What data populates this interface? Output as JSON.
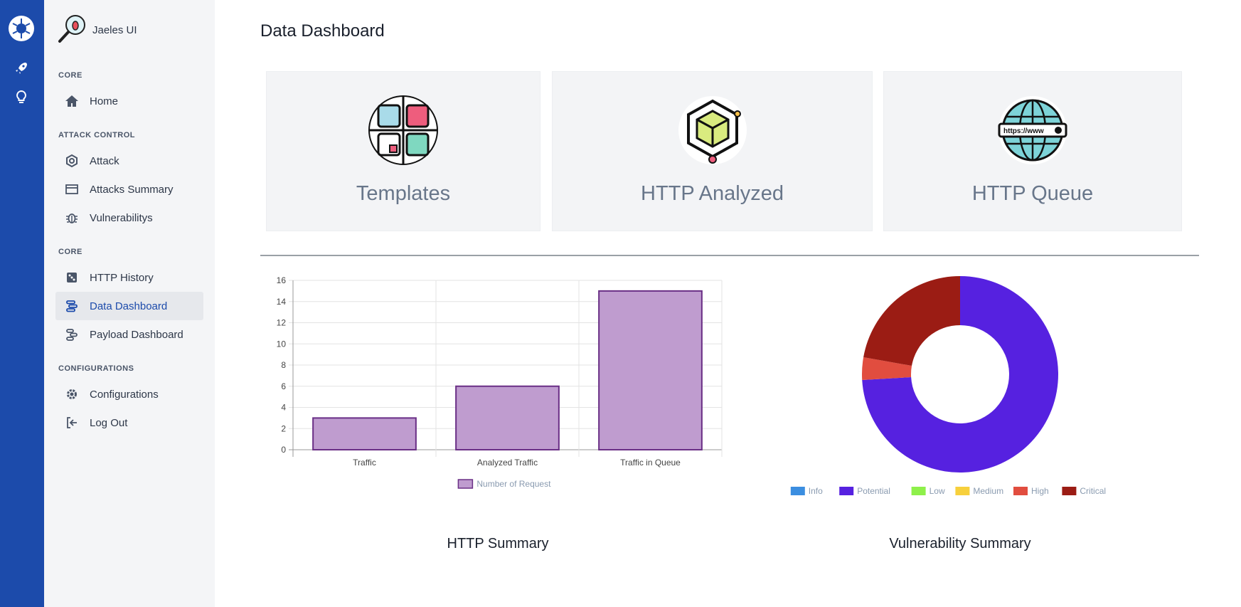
{
  "app": {
    "title": "Jaeles UI"
  },
  "sidebar": {
    "sections": [
      {
        "label": "CORE"
      },
      {
        "label": "ATTACK CONTROL"
      },
      {
        "label": "CORE"
      },
      {
        "label": "CONFIGURATIONS"
      }
    ],
    "items": [
      {
        "label": "Home",
        "icon": "home-icon"
      },
      {
        "label": "Attack",
        "icon": "hexagon-icon"
      },
      {
        "label": "Attacks Summary",
        "icon": "window-icon"
      },
      {
        "label": "Vulnerabilitys",
        "icon": "bug-icon"
      },
      {
        "label": "HTTP History",
        "icon": "dice-icon"
      },
      {
        "label": "Data Dashboard",
        "icon": "dashboard-icon",
        "active": true
      },
      {
        "label": "Payload Dashboard",
        "icon": "payload-icon"
      },
      {
        "label": "Configurations",
        "icon": "gear-icon"
      },
      {
        "label": "Log Out",
        "icon": "logout-icon"
      }
    ]
  },
  "rail": {
    "icons": [
      "app-logo-icon",
      "rocket-icon",
      "lightbulb-icon"
    ]
  },
  "main": {
    "title": "Data Dashboard",
    "cards": [
      {
        "title": "Templates",
        "icon": "templates-icon"
      },
      {
        "title": "HTTP Analyzed",
        "icon": "cube-icon"
      },
      {
        "title": "HTTP Queue",
        "icon": "globe-icon"
      }
    ]
  },
  "colors": {
    "rail": "#1c4bab",
    "accent": "#1c4bab",
    "bar_fill": "#bf9ccf",
    "bar_stroke": "#6a2f86"
  },
  "chart_data": [
    {
      "type": "bar",
      "title": "HTTP Summary",
      "categories": [
        "Traffic",
        "Analyzed Traffic",
        "Traffic in Queue"
      ],
      "series": [
        {
          "name": "Number of Request",
          "values": [
            3,
            6,
            15
          ]
        }
      ],
      "ylim": [
        0,
        16
      ],
      "yticks": [
        "0",
        "2",
        "4",
        "6",
        "8",
        "10",
        "12",
        "14",
        "16"
      ],
      "grid": true,
      "legend": "bottom"
    },
    {
      "type": "pie",
      "donut": true,
      "title": "Vulnerability Summary",
      "labels": [
        "Info",
        "Potential",
        "Low",
        "Medium",
        "High",
        "Critical"
      ],
      "values": [
        0,
        20,
        0,
        0,
        1,
        6
      ],
      "colors": [
        "#3b8ee0",
        "#5621e0",
        "#8ef04a",
        "#f7d03c",
        "#e14d3f",
        "#9b1c14"
      ],
      "legend": "bottom"
    }
  ]
}
